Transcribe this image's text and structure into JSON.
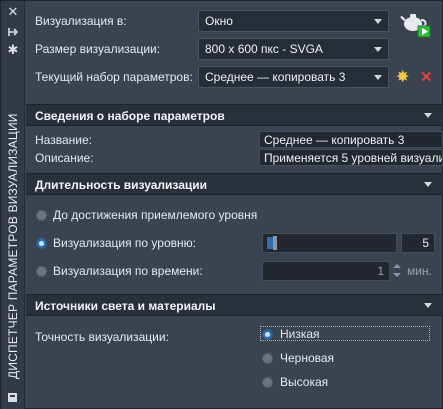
{
  "palette": {
    "title": "ДИСПЕТЧЕР ПАРАМЕТРОВ ВИЗУАЛИЗАЦИИ"
  },
  "top": {
    "render_in_label": "Визуализация в:",
    "render_in_value": "Окно",
    "render_size_label": "Размер визуализации:",
    "render_size_value": "800 x 600 пкс - SVGA",
    "current_preset_label": "Текущий набор параметров:",
    "current_preset_value": "Среднее — копировать 3"
  },
  "preset_info": {
    "header": "Сведения о наборе параметров",
    "name_label": "Название:",
    "name_value": "Среднее — копировать 3",
    "description_label": "Описание:",
    "description_value": "Применяется 5 уровней визуализации"
  },
  "duration": {
    "header": "Длительность визуализации",
    "option_until_acceptable": "До достижения приемлемого уровня",
    "option_by_level": "Визуализация по уровню:",
    "level_value": "5",
    "level_fraction": 0.05,
    "option_by_time": "Визуализация по времени:",
    "time_value": "1",
    "time_unit": "мин."
  },
  "lights": {
    "header": "Источники света и материалы",
    "accuracy_label": "Точность визуализации:",
    "option_low": "Низкая",
    "option_draft": "Черновая",
    "option_high": "Высокая"
  },
  "icons": {
    "close": "close-icon",
    "pin": "auto-hide-icon",
    "settings": "properties-icon",
    "teapot": "render-teapot-icon",
    "new": "new-preset-icon",
    "delete": "delete-preset-icon"
  },
  "colors": {
    "accent": "#2f6fb0",
    "delete": "#e0443e",
    "new": "#f3c646",
    "play": "#2dbf3b"
  }
}
